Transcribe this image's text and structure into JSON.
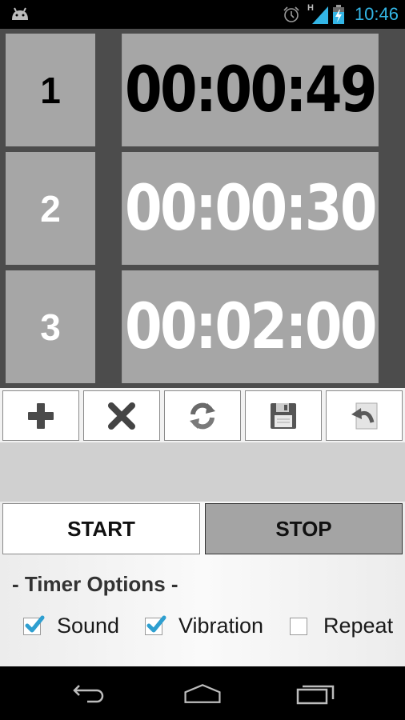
{
  "status_bar": {
    "time": "10:46",
    "network_type": "H",
    "icons": [
      "android-icon",
      "alarm-icon",
      "signal-icon",
      "battery-charging-icon"
    ]
  },
  "timers": [
    {
      "index": "1",
      "time": "00:00:49",
      "state": "active"
    },
    {
      "index": "2",
      "time": "00:00:30",
      "state": "inactive"
    },
    {
      "index": "3",
      "time": "00:02:00",
      "state": "inactive"
    }
  ],
  "toolbar": {
    "buttons": [
      {
        "name": "add",
        "icon": "plus-icon"
      },
      {
        "name": "delete",
        "icon": "close-icon"
      },
      {
        "name": "reset",
        "icon": "refresh-icon"
      },
      {
        "name": "save",
        "icon": "floppy-disk-icon"
      },
      {
        "name": "load",
        "icon": "undo-document-icon"
      }
    ]
  },
  "controls": {
    "start_label": "START",
    "stop_label": "STOP"
  },
  "options": {
    "title": "- Timer Options -",
    "items": [
      {
        "label": "Sound",
        "checked": true
      },
      {
        "label": "Vibration",
        "checked": true
      },
      {
        "label": "Repeat",
        "checked": false
      }
    ]
  },
  "colors": {
    "accent": "#33b5e5",
    "cell_bg": "#a6a6a6",
    "grid_border": "#4c4c4c",
    "checkmark": "#2e9fd0"
  },
  "nav_bar": {
    "buttons": [
      "back",
      "home",
      "recent-apps"
    ]
  }
}
